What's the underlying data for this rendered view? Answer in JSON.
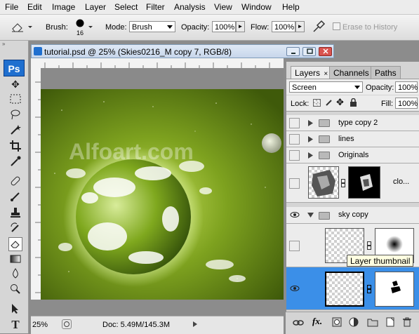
{
  "menu": [
    "File",
    "Edit",
    "Image",
    "Layer",
    "Select",
    "Filter",
    "Analysis",
    "View",
    "Window",
    "Help"
  ],
  "options": {
    "brush_label": "Brush:",
    "brush_size": "16",
    "mode_label": "Mode:",
    "mode_value": "Brush",
    "opacity_label": "Opacity:",
    "opacity_value": "100%",
    "flow_label": "Flow:",
    "flow_value": "100%",
    "erase_history_label": "Erase to History"
  },
  "toolbar": {
    "logo": "Ps"
  },
  "document": {
    "title": "tutorial.psd @ 25% (Skies0216_M copy 7, RGB/8)",
    "watermark": "Alfoart.com",
    "zoom": "25%",
    "doc_info": "Doc: 5.49M/145.3M"
  },
  "layers_panel": {
    "tabs": [
      "Layers",
      "Channels",
      "Paths"
    ],
    "blend_mode": "Screen",
    "opacity_label": "Opacity:",
    "opacity_value": "100%",
    "lock_label": "Lock:",
    "fill_label": "Fill:",
    "fill_value": "100%",
    "layers": [
      "type copy 2",
      "lines",
      "Originals",
      "clo...",
      "sky copy"
    ],
    "tooltip": "Layer thumbnail"
  },
  "colors": {
    "accent_blue": "#3b8fe8",
    "canvas_green": "#6f9a1a",
    "planet_glow": "#e8ffb0"
  }
}
